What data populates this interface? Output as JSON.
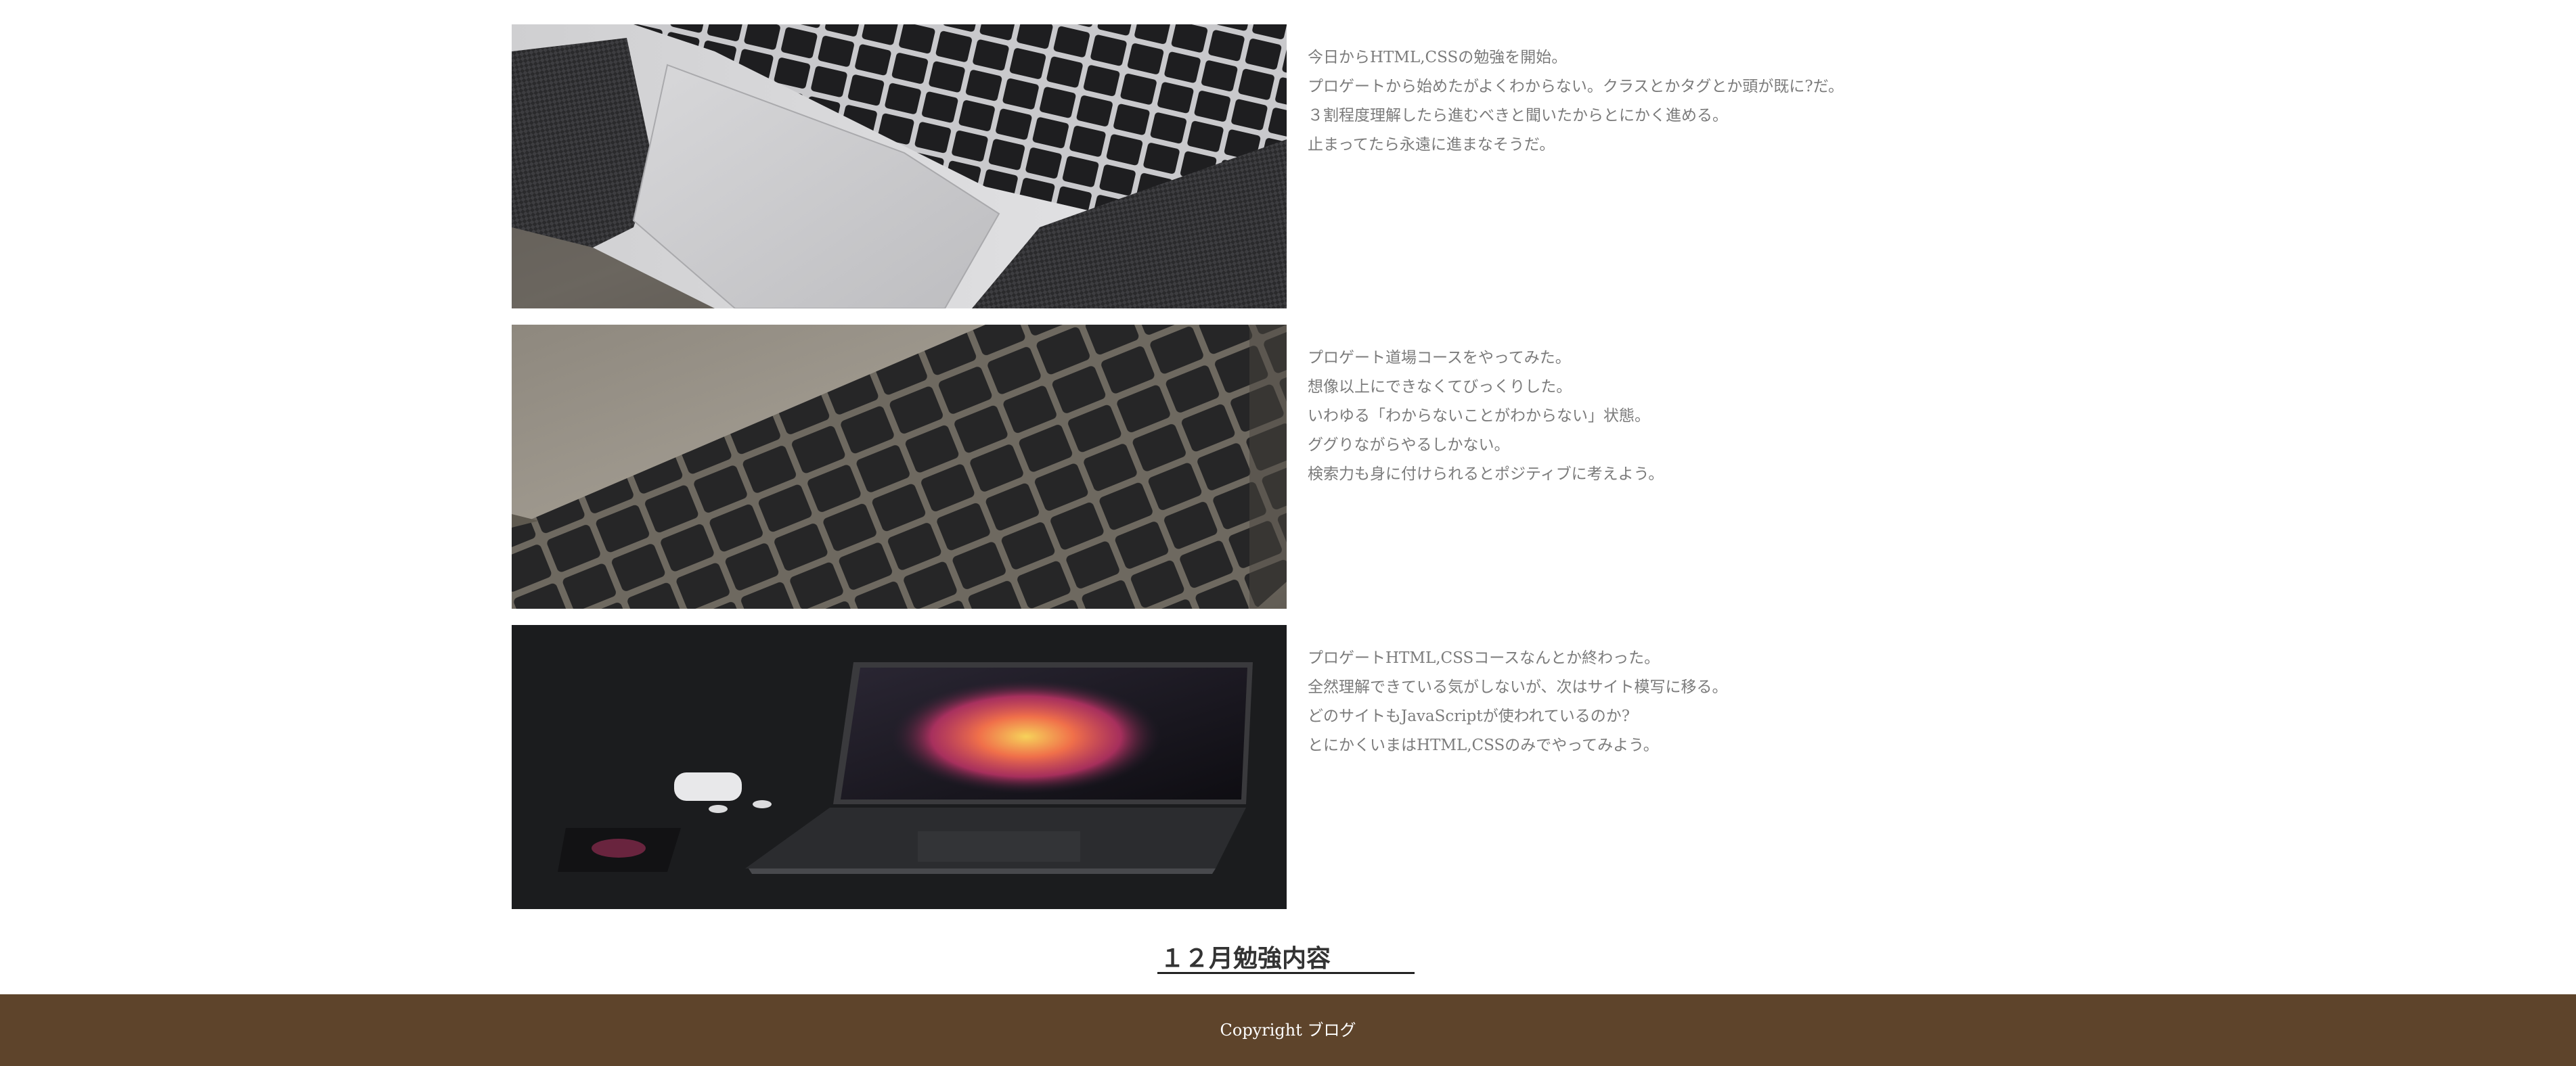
{
  "posts": [
    {
      "image": "laptop-trackpad-carbon-photo",
      "lines": [
        "今日からHTML,CSSの勉強を開始。",
        "プロゲートから始めたがよくわからない。クラスとかタグとか頭が既に?だ。",
        "３割程度理解したら進むべきと聞いたからとにかく進める。",
        "止まってたら永遠に進まなそうだ。"
      ]
    },
    {
      "image": "keyboard-closeup-photo",
      "lines": [
        "プロゲート道場コースをやってみた。",
        "想像以上にできなくてびっくりした。",
        "いわゆる「わからないことがわからない」状態。",
        "ググりながらやるしかない。",
        "検索力も身に付けられるとポジティブに考えよう。"
      ]
    },
    {
      "image": "macbook-dark-desk-photo",
      "lines": [
        "プロゲートHTML,CSSコースなんとか終わった。",
        "全然理解できている気がしないが、次はサイト模写に移る。",
        "どのサイトもJavaScriptが使われているのか?",
        "とにかくいまはHTML,CSSのみでやってみよう。"
      ]
    }
  ],
  "section_heading": "１２月勉強内容",
  "footer": {
    "copyright": "Copyright ブログ"
  },
  "colors": {
    "footer_background": "#5e442b",
    "body_text": "#7b7b7b",
    "heading_text": "#333333"
  }
}
